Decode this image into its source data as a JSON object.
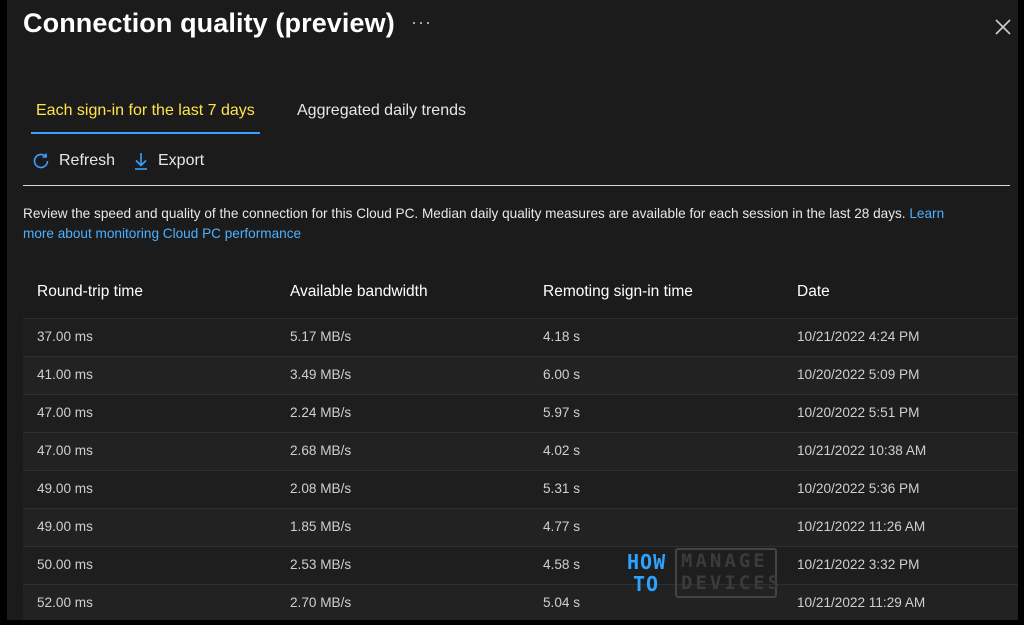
{
  "header": {
    "title": "Connection quality (preview)",
    "more_label": "···"
  },
  "tabs": [
    {
      "label": "Each sign-in for the last 7 days",
      "active": true
    },
    {
      "label": "Aggregated daily trends",
      "active": false
    }
  ],
  "toolbar": {
    "refresh_label": "Refresh",
    "refresh_icon": "refresh-icon",
    "export_label": "Export",
    "export_icon": "download-icon"
  },
  "description": {
    "text": "Review the speed and quality of the connection for this Cloud PC. Median daily quality measures are available for each session in the last 28 days.",
    "link": "Learn more about monitoring Cloud PC performance"
  },
  "table": {
    "columns": [
      "Round-trip time",
      "Available bandwidth",
      "Remoting sign-in time",
      "Date"
    ],
    "rows": [
      [
        "37.00 ms",
        "5.17 MB/s",
        "4.18 s",
        "10/21/2022 4:24 PM"
      ],
      [
        "41.00 ms",
        "3.49 MB/s",
        "6.00 s",
        "10/20/2022 5:09 PM"
      ],
      [
        "47.00 ms",
        "2.24 MB/s",
        "5.97 s",
        "10/20/2022 5:51 PM"
      ],
      [
        "47.00 ms",
        "2.68 MB/s",
        "4.02 s",
        "10/21/2022 10:38 AM"
      ],
      [
        "49.00 ms",
        "2.08 MB/s",
        "5.31 s",
        "10/20/2022 5:36 PM"
      ],
      [
        "49.00 ms",
        "1.85 MB/s",
        "4.77 s",
        "10/21/2022 11:26 AM"
      ],
      [
        "50.00 ms",
        "2.53 MB/s",
        "4.58 s",
        "10/21/2022 3:32 PM"
      ],
      [
        "52.00 ms",
        "2.70 MB/s",
        "5.04 s",
        "10/21/2022 11:29 AM"
      ]
    ]
  },
  "watermark": {
    "line1_left": "HOW",
    "line2_left": "TO",
    "line1_right": "MANAGE",
    "line2_right": "DEVICES"
  },
  "colors": {
    "background": "#1b1b1b",
    "active_tab_text": "#ffe34d",
    "active_tab_underline": "#3aa0ff",
    "link": "#4db0ff"
  }
}
